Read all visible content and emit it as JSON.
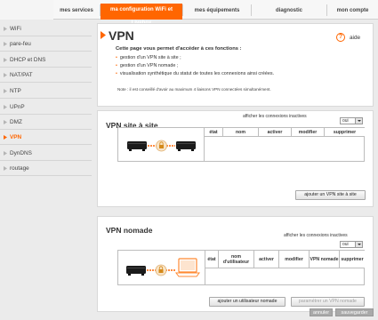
{
  "nav": {
    "tabs": [
      {
        "label": "mes services"
      },
      {
        "label": "ma configuration WiFi et Livebox"
      },
      {
        "label": "mes équipements"
      },
      {
        "label": "diagnostic"
      },
      {
        "label": "mon compte"
      }
    ]
  },
  "sidebar": {
    "items": [
      {
        "label": "WiFi"
      },
      {
        "label": "pare-feu"
      },
      {
        "label": "DHCP et DNS"
      },
      {
        "label": "NAT/PAT"
      },
      {
        "label": "NTP"
      },
      {
        "label": "UPnP"
      },
      {
        "label": "DMZ"
      },
      {
        "label": "VPN"
      },
      {
        "label": "DynDNS"
      },
      {
        "label": "routage"
      }
    ]
  },
  "header": {
    "title": "VPN",
    "help_label": "aide",
    "help_icon": "?",
    "intro": "Cette page vous permet d'accéder à ces fonctions :",
    "bullets": [
      "gestion d'un VPN site à site ;",
      "gestion d'un VPN nomade ;",
      "visualisation synthétique du statut de toutes les connexions ainsi créées."
    ],
    "note": "Note : il est conseillé d'avoir au maximum 4 liaisons VPN connectées simultanément."
  },
  "site_to_site": {
    "title": "VPN site à site",
    "show_inactive_label": "afficher les connexions inactives",
    "select_value": "oui",
    "columns": [
      "état",
      "nom",
      "activer",
      "modifier",
      "supprimer"
    ],
    "add_button": "ajouter un VPN site à site"
  },
  "nomade": {
    "title": "VPN nomade",
    "show_inactive_label": "afficher les connexions inactives",
    "select_value": "oui",
    "columns": [
      "état",
      "nom d'utilisateur",
      "activer",
      "modifier",
      "VPN nomade",
      "supprimer"
    ],
    "add_user_button": "ajouter un utilisateur nomade",
    "settings_button": "paramétrer un VPN nomade"
  },
  "footer": {
    "cancel_label": "annuler",
    "save_label": "sauvegarder"
  },
  "colors": {
    "accent": "#ff6600",
    "background": "#ebebeb"
  }
}
